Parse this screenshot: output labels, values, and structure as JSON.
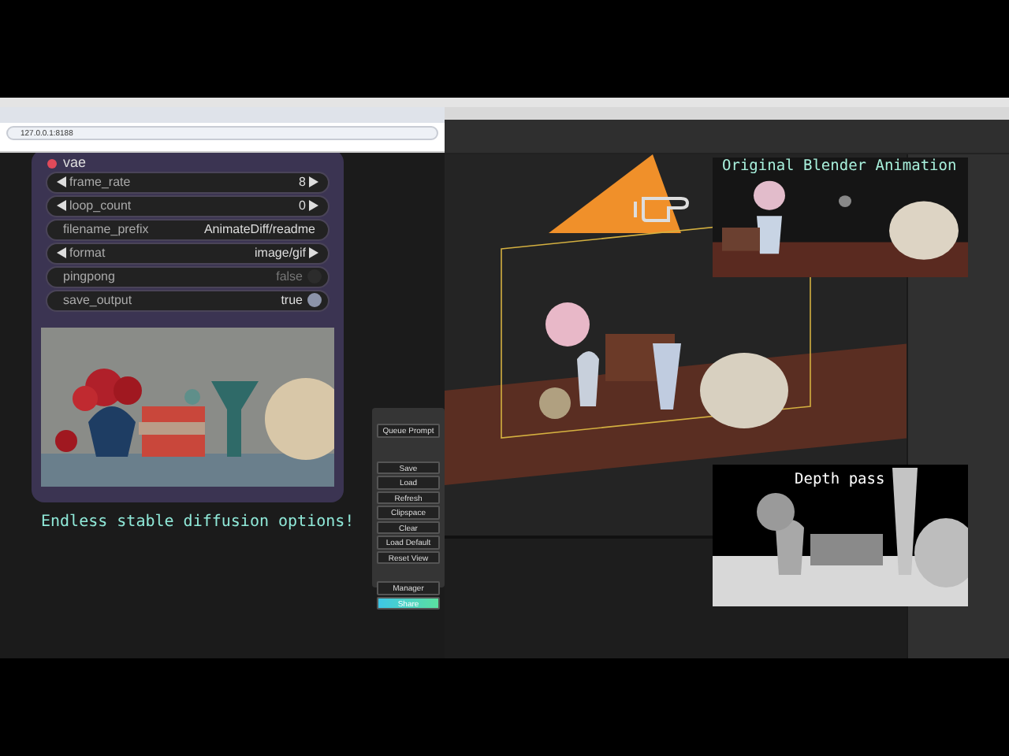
{
  "browser": {
    "address": "127.0.0.1:8188"
  },
  "node": {
    "title": "vae",
    "widgets": [
      {
        "kind": "number",
        "label": "frame_rate",
        "value": "8"
      },
      {
        "kind": "number",
        "label": "loop_count",
        "value": "0"
      },
      {
        "kind": "text",
        "label": "filename_prefix",
        "value": "AnimateDiff/readme"
      },
      {
        "kind": "combo",
        "label": "format",
        "value": "image/gif"
      },
      {
        "kind": "toggle",
        "label": "pingpong",
        "value": "false",
        "on": false
      },
      {
        "kind": "toggle",
        "label": "save_output",
        "value": "true",
        "on": true
      }
    ]
  },
  "caption": "Endless stable diffusion options!",
  "queue_panel": {
    "buttons": [
      {
        "label": "Queue Prompt",
        "kind": "primary"
      },
      {
        "label": "Save",
        "kind": "plain"
      },
      {
        "label": "Load",
        "kind": "plain"
      },
      {
        "label": "Refresh",
        "kind": "plain"
      },
      {
        "label": "Clipspace",
        "kind": "plain"
      },
      {
        "label": "Clear",
        "kind": "plain"
      },
      {
        "label": "Load Default",
        "kind": "plain"
      },
      {
        "label": "Reset View",
        "kind": "plain"
      },
      {
        "label": "Manager",
        "kind": "plain"
      },
      {
        "label": "Share",
        "kind": "accent"
      }
    ]
  },
  "viewport": {
    "original_label": "Original Blender Animation",
    "depth_label": "Depth pass"
  }
}
